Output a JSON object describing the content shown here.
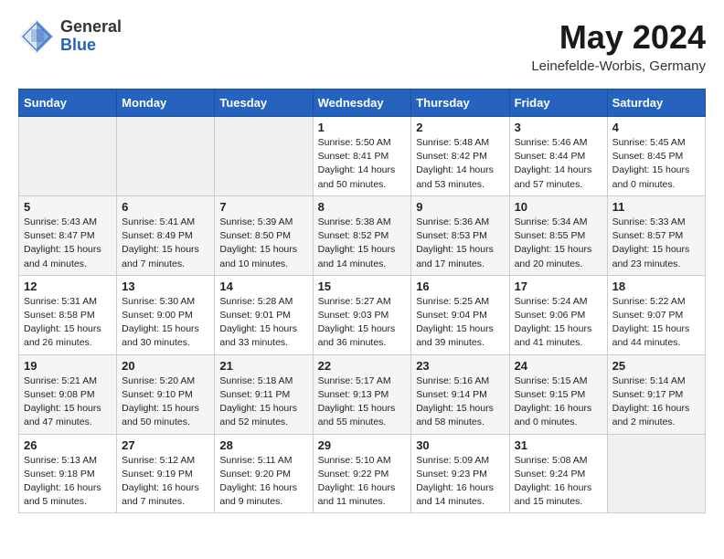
{
  "logo": {
    "general": "General",
    "blue": "Blue"
  },
  "header": {
    "month": "May 2024",
    "location": "Leinefelde-Worbis, Germany"
  },
  "weekdays": [
    "Sunday",
    "Monday",
    "Tuesday",
    "Wednesday",
    "Thursday",
    "Friday",
    "Saturday"
  ],
  "weeks": [
    [
      {
        "day": "",
        "info": ""
      },
      {
        "day": "",
        "info": ""
      },
      {
        "day": "",
        "info": ""
      },
      {
        "day": "1",
        "info": "Sunrise: 5:50 AM\nSunset: 8:41 PM\nDaylight: 14 hours\nand 50 minutes."
      },
      {
        "day": "2",
        "info": "Sunrise: 5:48 AM\nSunset: 8:42 PM\nDaylight: 14 hours\nand 53 minutes."
      },
      {
        "day": "3",
        "info": "Sunrise: 5:46 AM\nSunset: 8:44 PM\nDaylight: 14 hours\nand 57 minutes."
      },
      {
        "day": "4",
        "info": "Sunrise: 5:45 AM\nSunset: 8:45 PM\nDaylight: 15 hours\nand 0 minutes."
      }
    ],
    [
      {
        "day": "5",
        "info": "Sunrise: 5:43 AM\nSunset: 8:47 PM\nDaylight: 15 hours\nand 4 minutes."
      },
      {
        "day": "6",
        "info": "Sunrise: 5:41 AM\nSunset: 8:49 PM\nDaylight: 15 hours\nand 7 minutes."
      },
      {
        "day": "7",
        "info": "Sunrise: 5:39 AM\nSunset: 8:50 PM\nDaylight: 15 hours\nand 10 minutes."
      },
      {
        "day": "8",
        "info": "Sunrise: 5:38 AM\nSunset: 8:52 PM\nDaylight: 15 hours\nand 14 minutes."
      },
      {
        "day": "9",
        "info": "Sunrise: 5:36 AM\nSunset: 8:53 PM\nDaylight: 15 hours\nand 17 minutes."
      },
      {
        "day": "10",
        "info": "Sunrise: 5:34 AM\nSunset: 8:55 PM\nDaylight: 15 hours\nand 20 minutes."
      },
      {
        "day": "11",
        "info": "Sunrise: 5:33 AM\nSunset: 8:57 PM\nDaylight: 15 hours\nand 23 minutes."
      }
    ],
    [
      {
        "day": "12",
        "info": "Sunrise: 5:31 AM\nSunset: 8:58 PM\nDaylight: 15 hours\nand 26 minutes."
      },
      {
        "day": "13",
        "info": "Sunrise: 5:30 AM\nSunset: 9:00 PM\nDaylight: 15 hours\nand 30 minutes."
      },
      {
        "day": "14",
        "info": "Sunrise: 5:28 AM\nSunset: 9:01 PM\nDaylight: 15 hours\nand 33 minutes."
      },
      {
        "day": "15",
        "info": "Sunrise: 5:27 AM\nSunset: 9:03 PM\nDaylight: 15 hours\nand 36 minutes."
      },
      {
        "day": "16",
        "info": "Sunrise: 5:25 AM\nSunset: 9:04 PM\nDaylight: 15 hours\nand 39 minutes."
      },
      {
        "day": "17",
        "info": "Sunrise: 5:24 AM\nSunset: 9:06 PM\nDaylight: 15 hours\nand 41 minutes."
      },
      {
        "day": "18",
        "info": "Sunrise: 5:22 AM\nSunset: 9:07 PM\nDaylight: 15 hours\nand 44 minutes."
      }
    ],
    [
      {
        "day": "19",
        "info": "Sunrise: 5:21 AM\nSunset: 9:08 PM\nDaylight: 15 hours\nand 47 minutes."
      },
      {
        "day": "20",
        "info": "Sunrise: 5:20 AM\nSunset: 9:10 PM\nDaylight: 15 hours\nand 50 minutes."
      },
      {
        "day": "21",
        "info": "Sunrise: 5:18 AM\nSunset: 9:11 PM\nDaylight: 15 hours\nand 52 minutes."
      },
      {
        "day": "22",
        "info": "Sunrise: 5:17 AM\nSunset: 9:13 PM\nDaylight: 15 hours\nand 55 minutes."
      },
      {
        "day": "23",
        "info": "Sunrise: 5:16 AM\nSunset: 9:14 PM\nDaylight: 15 hours\nand 58 minutes."
      },
      {
        "day": "24",
        "info": "Sunrise: 5:15 AM\nSunset: 9:15 PM\nDaylight: 16 hours\nand 0 minutes."
      },
      {
        "day": "25",
        "info": "Sunrise: 5:14 AM\nSunset: 9:17 PM\nDaylight: 16 hours\nand 2 minutes."
      }
    ],
    [
      {
        "day": "26",
        "info": "Sunrise: 5:13 AM\nSunset: 9:18 PM\nDaylight: 16 hours\nand 5 minutes."
      },
      {
        "day": "27",
        "info": "Sunrise: 5:12 AM\nSunset: 9:19 PM\nDaylight: 16 hours\nand 7 minutes."
      },
      {
        "day": "28",
        "info": "Sunrise: 5:11 AM\nSunset: 9:20 PM\nDaylight: 16 hours\nand 9 minutes."
      },
      {
        "day": "29",
        "info": "Sunrise: 5:10 AM\nSunset: 9:22 PM\nDaylight: 16 hours\nand 11 minutes."
      },
      {
        "day": "30",
        "info": "Sunrise: 5:09 AM\nSunset: 9:23 PM\nDaylight: 16 hours\nand 14 minutes."
      },
      {
        "day": "31",
        "info": "Sunrise: 5:08 AM\nSunset: 9:24 PM\nDaylight: 16 hours\nand 15 minutes."
      },
      {
        "day": "",
        "info": ""
      }
    ]
  ]
}
